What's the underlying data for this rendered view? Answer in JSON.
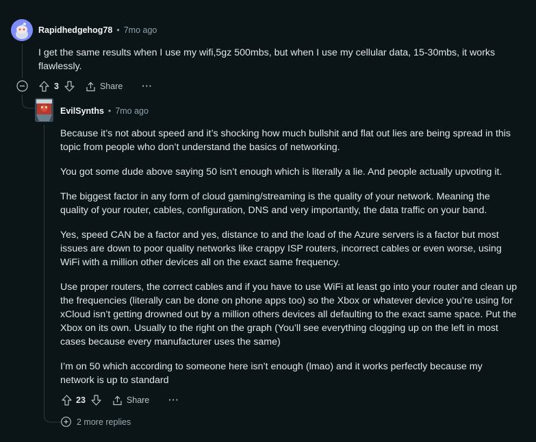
{
  "comment1": {
    "username": "Rapidhedgehog78",
    "age": "7mo ago",
    "body": "I get the same results when I use my wifi,5gz 500mbs, but when I use my cellular data, 15-30mbs, it works flawlessly.",
    "votes": "3",
    "share_label": "Share",
    "more_label": "···"
  },
  "comment2": {
    "username": "EvilSynths",
    "age": "7mo ago",
    "paragraphs": [
      "Because it’s not about speed and it’s shocking how much bullshit and flat out lies are being spread in this topic from people who don’t understand the basics of networking.",
      "You got some dude above saying 50 isn’t enough which is literally a lie. And people actually upvoting it.",
      "The biggest factor in any form of cloud gaming/streaming is the quality of your network. Meaning the quality of your router, cables, configuration, DNS and very importantly, the data traffic on your band.",
      "Yes, speed CAN be a factor and yes, distance to and the load of the Azure servers is a factor but most issues are down to poor quality networks like crappy ISP routers, incorrect cables or even worse, using WiFi with a million other devices all on the exact same frequency.",
      "Use proper routers, the correct cables and if you have to use WiFi at least go into your router and clean up the frequencies (literally can be done on phone apps too) so the Xbox or whatever device you’re using for xCloud isn’t getting drowned out by a million others devices all defaulting to the exact same space. Put the Xbox on its own. Usually to the right on the graph (You’ll see everything clogging up on the left in most cases because every manufacturer uses the same)",
      "I’m on 50 which according to someone here isn’t enough (lmao) and it works perfectly because my network is up to standard"
    ],
    "votes": "23",
    "share_label": "Share",
    "more_label": "···"
  },
  "more_replies": "2 more replies",
  "separator": "•"
}
